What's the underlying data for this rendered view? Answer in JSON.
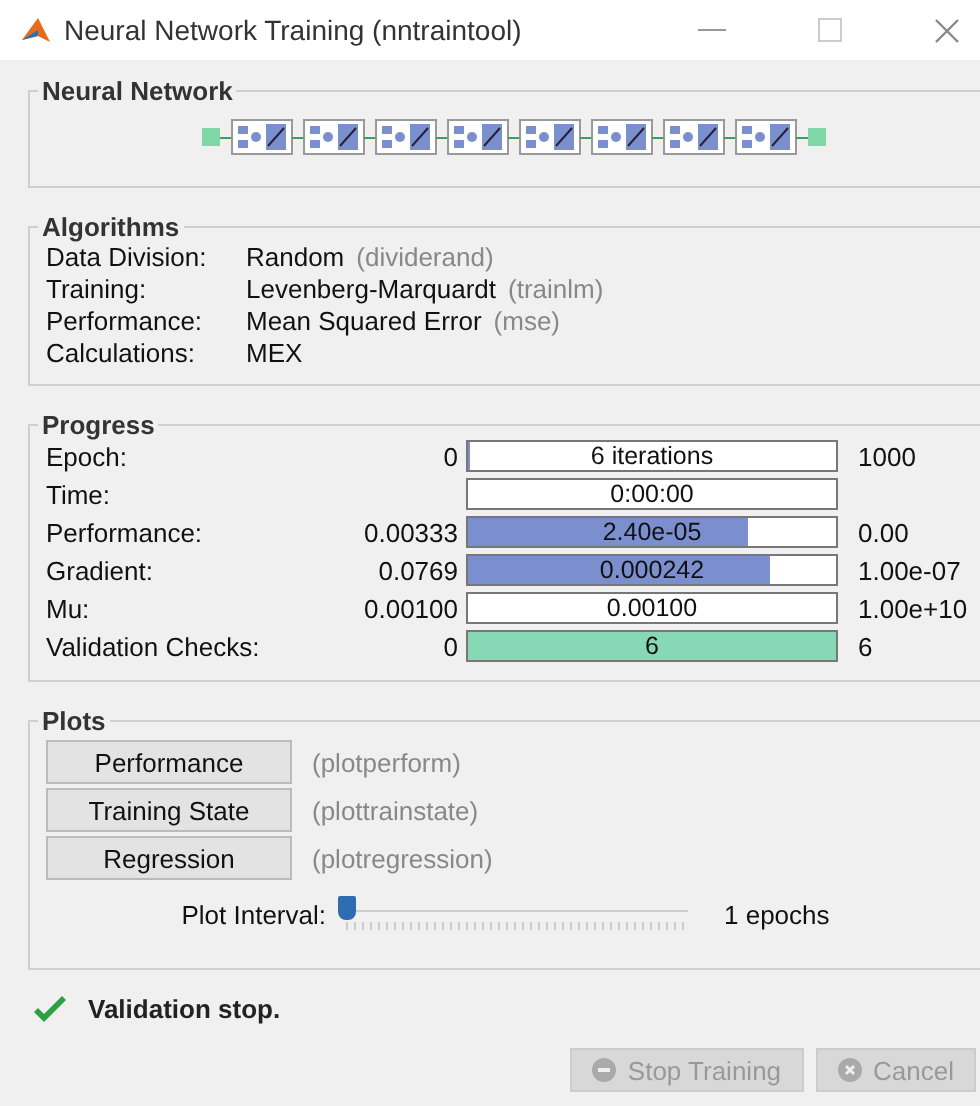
{
  "window": {
    "title": "Neural Network Training (nntraintool)"
  },
  "neural_network": {
    "title": "Neural Network"
  },
  "algorithms": {
    "title": "Algorithms",
    "rows": [
      {
        "label": "Data Division:",
        "value": "Random",
        "function": "(dividerand)"
      },
      {
        "label": "Training:",
        "value": "Levenberg-Marquardt",
        "function": "(trainlm)"
      },
      {
        "label": "Performance:",
        "value": "Mean Squared Error",
        "function": "(mse)"
      },
      {
        "label": "Calculations:",
        "value": "MEX"
      }
    ]
  },
  "progress": {
    "title": "Progress",
    "rows": [
      {
        "kind": "bar",
        "label": "Epoch:",
        "start": "0",
        "reading": "6 iterations",
        "end": "1000",
        "level": 0.006,
        "color": "#7b8fcf"
      },
      {
        "kind": "field",
        "label": "Time:",
        "reading": "0:00:00"
      },
      {
        "kind": "bar",
        "label": "Performance:",
        "start": "0.00333",
        "reading": "2.40e-05",
        "end": "0.00",
        "level": 0.76,
        "color": "#7b8fcf"
      },
      {
        "kind": "bar",
        "label": "Gradient:",
        "start": "0.0769",
        "reading": "0.000242",
        "end": "1.00e-07",
        "level": 0.82,
        "color": "#7b8fcf"
      },
      {
        "kind": "field",
        "label": "Mu:",
        "start": "0.00100",
        "reading": "0.00100",
        "end": "1.00e+10"
      },
      {
        "kind": "bar",
        "label": "Validation Checks:",
        "start": "0",
        "reading": "6",
        "end": "6",
        "level": 1,
        "color": "#86d9b4"
      }
    ]
  },
  "plots": {
    "title": "Plots",
    "buttons": [
      {
        "label": "Performance",
        "function": "(plotperform)"
      },
      {
        "label": "Training State",
        "function": "(plottrainstate)"
      },
      {
        "label": "Regression",
        "function": "(plotregression)"
      }
    ],
    "interval": {
      "label": "Plot Interval:",
      "level": 0,
      "reading": "1 epochs"
    }
  },
  "status": {
    "text": "Validation stop.",
    "done": true
  },
  "buttons": [
    {
      "kind": "stop",
      "label": "Stop Training",
      "disabled": true
    },
    {
      "kind": "cancel",
      "label": "Cancel",
      "disabled": true
    }
  ]
}
